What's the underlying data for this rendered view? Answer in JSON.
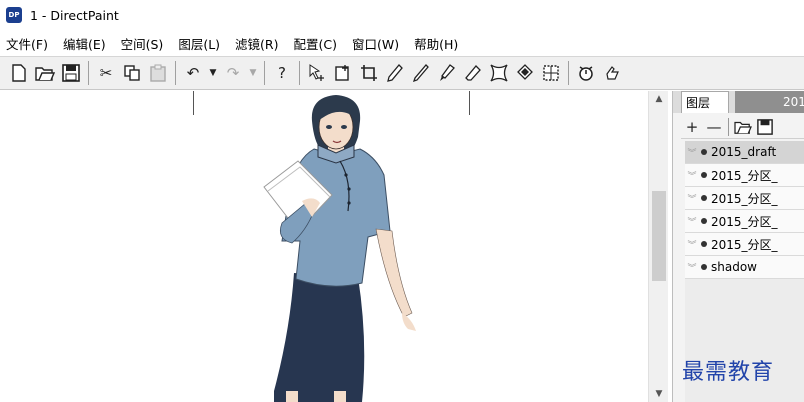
{
  "window": {
    "logo_text": "DP",
    "title": "1 - DirectPaint"
  },
  "menu": {
    "items": [
      "文件(F)",
      "编辑(E)",
      "空间(S)",
      "图层(L)",
      "滤镜(R)",
      "配置(C)",
      "窗口(W)",
      "帮助(H)"
    ]
  },
  "toolbar": {
    "new_icon": "new-document-icon",
    "open_icon": "open-folder-icon",
    "save_icon": "save-disk-icon",
    "cut_glyph": "✂",
    "undo_glyph": "↶",
    "redo_glyph": "↷",
    "help_glyph": "?",
    "dropdown_glyph": "▼"
  },
  "layers_panel": {
    "active_tab": "图层",
    "inactive_tab": "201",
    "add_glyph": "+",
    "remove_glyph": "—",
    "layers": [
      {
        "name": "2015_draft",
        "selected": true
      },
      {
        "name": "2015_分区_",
        "selected": false
      },
      {
        "name": "2015_分区_",
        "selected": false
      },
      {
        "name": "2015_分区_",
        "selected": false
      },
      {
        "name": "2015_分区_",
        "selected": false
      },
      {
        "name": "shadow",
        "selected": false
      }
    ]
  },
  "scrollbar": {
    "up_glyph": "▲",
    "down_glyph": "▼"
  },
  "watermark": {
    "text": "最需教育"
  },
  "colors": {
    "logo_bg": "#1b3f8f",
    "qipao": "#7f9fbd",
    "skirt": "#273650",
    "hair": "#2c3a4c",
    "skin": "#f3ddcb",
    "watermark": "#2244aa"
  }
}
